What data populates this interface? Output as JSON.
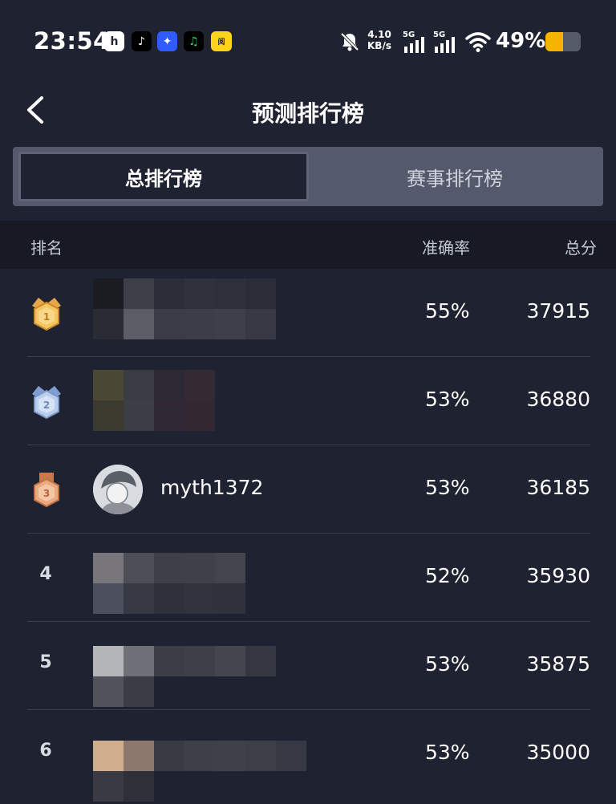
{
  "status_bar": {
    "time": "23:54",
    "apps": [
      {
        "name": "app-icon-1",
        "glyph": "h"
      },
      {
        "name": "tiktok-icon",
        "glyph": "♪"
      },
      {
        "name": "app-icon-3",
        "glyph": "✦"
      },
      {
        "name": "music-icon",
        "glyph": "♫"
      },
      {
        "name": "app-icon-5",
        "glyph": "阅"
      }
    ],
    "net_speed_value": "4.10",
    "net_speed_unit": "KB/s",
    "signal1_label": "5G",
    "signal2_label": "5G",
    "battery_percent_text": "49%",
    "battery_level": 0.49,
    "battery_color": "#f5b400"
  },
  "header": {
    "title": "预测排行榜",
    "back_icon": "chevron-left-icon"
  },
  "tabs": [
    {
      "label": "总排行榜",
      "active": true
    },
    {
      "label": "赛事排行榜",
      "active": false
    }
  ],
  "table": {
    "columns": {
      "rank": "排名",
      "accuracy": "准确率",
      "score": "总分"
    },
    "rows": [
      {
        "rank": "1",
        "medal": "gold-medal-icon",
        "user": "",
        "accuracy": "55%",
        "score": "37915"
      },
      {
        "rank": "2",
        "medal": "silver-medal-icon",
        "user": "",
        "accuracy": "53%",
        "score": "36880"
      },
      {
        "rank": "3",
        "medal": "bronze-medal-icon",
        "user": "myth1372",
        "accuracy": "53%",
        "score": "36185"
      },
      {
        "rank": "4",
        "user": "",
        "accuracy": "52%",
        "score": "35930"
      },
      {
        "rank": "5",
        "user": "",
        "accuracy": "53%",
        "score": "35875"
      },
      {
        "rank": "6",
        "user": "",
        "accuracy": "53%",
        "score": "35000"
      }
    ]
  },
  "colors": {
    "background": "#1f2230",
    "header_row_bg": "#171a25",
    "tab_bar_bg": "#54596b",
    "gold": "#f0b24a",
    "silver": "#a9c0e6",
    "bronze": "#e39a6b"
  }
}
